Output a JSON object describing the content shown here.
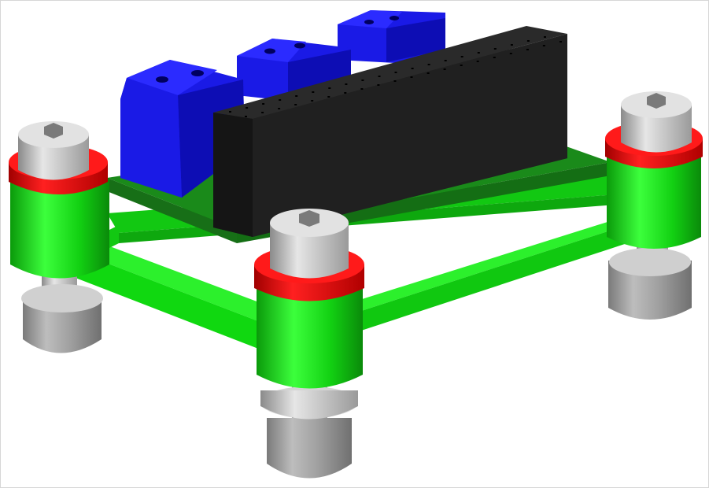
{
  "scene": {
    "description_visible_text": "",
    "components": [
      {
        "type": "pcb",
        "color": "#1f8f1f"
      },
      {
        "type": "terminal-block",
        "count": 3,
        "color": "#1414e6"
      },
      {
        "type": "pin-header",
        "color": "#1e1e1e"
      },
      {
        "type": "frame",
        "color": "#12e012"
      },
      {
        "type": "standoff",
        "count": 4,
        "color": "#12e012"
      },
      {
        "type": "washer",
        "count": 4,
        "color": "#e60f0f"
      },
      {
        "type": "socket-head-screw",
        "count": 4,
        "color": "#c8c8c8"
      },
      {
        "type": "lock-nut",
        "count": 4,
        "color": "#a8a8a8"
      }
    ]
  }
}
